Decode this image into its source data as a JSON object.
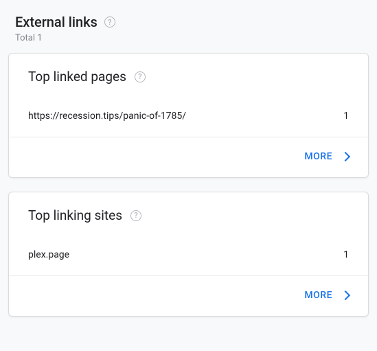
{
  "header": {
    "title": "External links",
    "subtitle": "Total 1"
  },
  "cards": {
    "linked_pages": {
      "title": "Top linked pages",
      "item_label": "https://recession.tips/panic-of-1785/",
      "item_count": "1",
      "more_label": "More"
    },
    "linking_sites": {
      "title": "Top linking sites",
      "item_label": "plex.page",
      "item_count": "1",
      "more_label": "More"
    }
  }
}
